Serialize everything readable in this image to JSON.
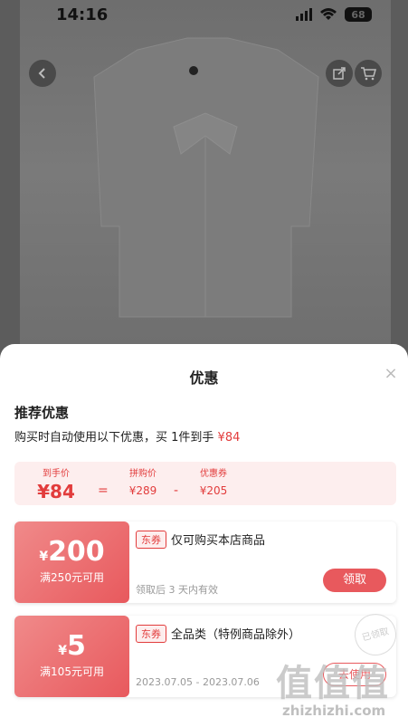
{
  "status": {
    "time": "14:16",
    "battery": "68"
  },
  "sheet": {
    "title": "优惠",
    "close": "×",
    "section_title": "推荐优惠",
    "subtitle_prefix": "购买时自动使用以下优惠，买 1件到手 ",
    "subtitle_price": "¥84"
  },
  "price_breakdown": {
    "final_label": "到手价",
    "final_value": "¥84",
    "equals": "=",
    "group_label": "拼购价",
    "group_value": "¥289",
    "minus": "-",
    "coupon_label": "优惠券",
    "coupon_value": "¥205"
  },
  "coupons": [
    {
      "yen": "¥",
      "amount": "200",
      "condition": "满250元可用",
      "tag": "东券",
      "description": "仅可购买本店商品",
      "validity": "领取后 3 天内有效",
      "action": "领取"
    },
    {
      "yen": "¥",
      "amount": "5",
      "condition": "满105元可用",
      "tag": "东券",
      "description": "全品类（特例商品除外）",
      "validity": "2023.07.05 - 2023.07.06",
      "action": "去使用",
      "stamp": "已领取"
    }
  ],
  "watermark": {
    "logo": "值值值",
    "text": "zhizhizhi.com"
  },
  "colors": {
    "accent": "#e8595d",
    "price_red": "#e23c3c",
    "price_bg": "#fdeeee"
  }
}
